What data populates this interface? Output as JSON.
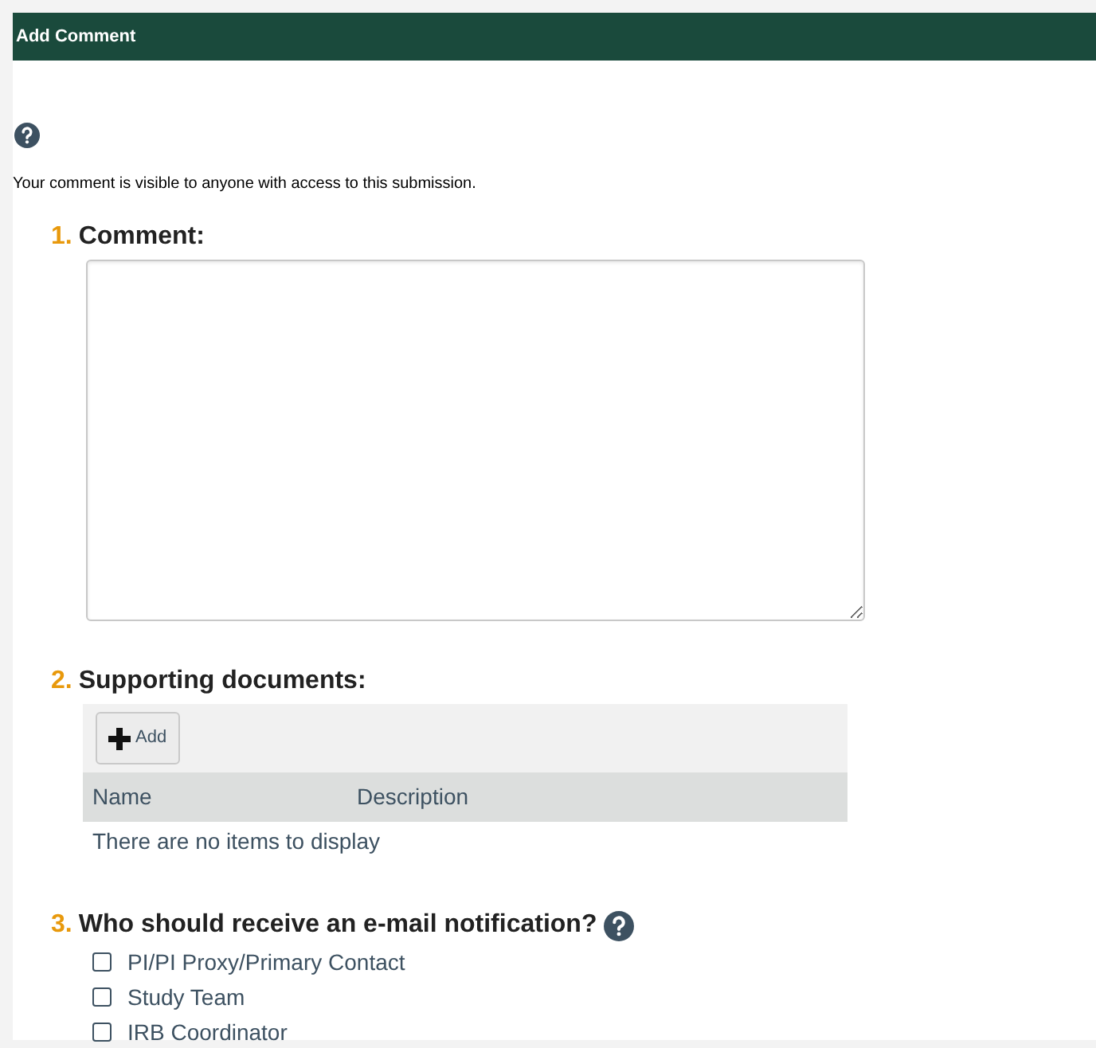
{
  "header": {
    "title": "Add Comment"
  },
  "notice": "Your comment is visible to anyone with access to this submission.",
  "sections": [
    {
      "kind": "textarea",
      "number": "1.",
      "label": "Comment:"
    },
    {
      "kind": "documents",
      "number": "2.",
      "label": "Supporting documents:",
      "add_button": "Add",
      "columns": [
        "Name",
        "Description"
      ],
      "empty_text": "There are no items to display"
    },
    {
      "kind": "checklist",
      "number": "3.",
      "label": "Who should receive an e-mail notification?",
      "help": true,
      "options": [
        {
          "label": "PI/PI Proxy/Primary Contact",
          "checked": false
        },
        {
          "label": "Study Team",
          "checked": false
        },
        {
          "label": "IRB Coordinator",
          "checked": false
        }
      ]
    }
  ]
}
